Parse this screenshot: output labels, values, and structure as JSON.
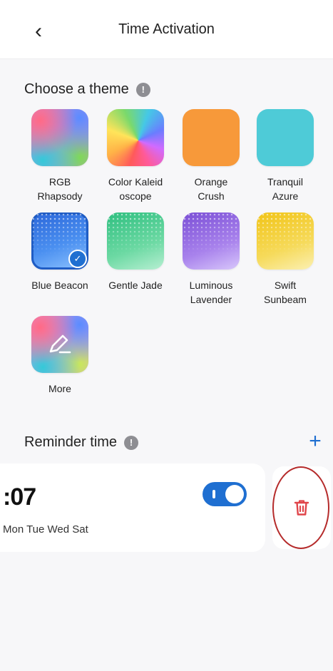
{
  "header": {
    "back_icon": "chevron-left-icon",
    "back_glyph": "‹",
    "title": "Time Activation"
  },
  "theme_section": {
    "heading": "Choose a theme",
    "info_glyph": "!",
    "themes": [
      {
        "label": "RGB\nRhapsody",
        "selected": false
      },
      {
        "label": "Color Kaleid\noscope",
        "selected": false
      },
      {
        "label": "Orange\nCrush",
        "selected": false
      },
      {
        "label": "Tranquil\nAzure",
        "selected": false
      },
      {
        "label": "Blue Beacon",
        "selected": true
      },
      {
        "label": "Gentle Jade",
        "selected": false
      },
      {
        "label": "Luminous\nLavender",
        "selected": false
      },
      {
        "label": "Swift\nSunbeam",
        "selected": false
      },
      {
        "label": "More",
        "selected": false
      }
    ]
  },
  "reminder_section": {
    "heading": "Reminder time",
    "info_glyph": "!",
    "add_glyph": "+",
    "reminder": {
      "time": ":07",
      "days": "Mon Tue Wed Sat",
      "enabled": true
    },
    "delete_icon": "trash-icon"
  },
  "colors": {
    "accent": "#1f6fd1",
    "delete": "#e0454a",
    "annotation": "#b52b2b"
  }
}
